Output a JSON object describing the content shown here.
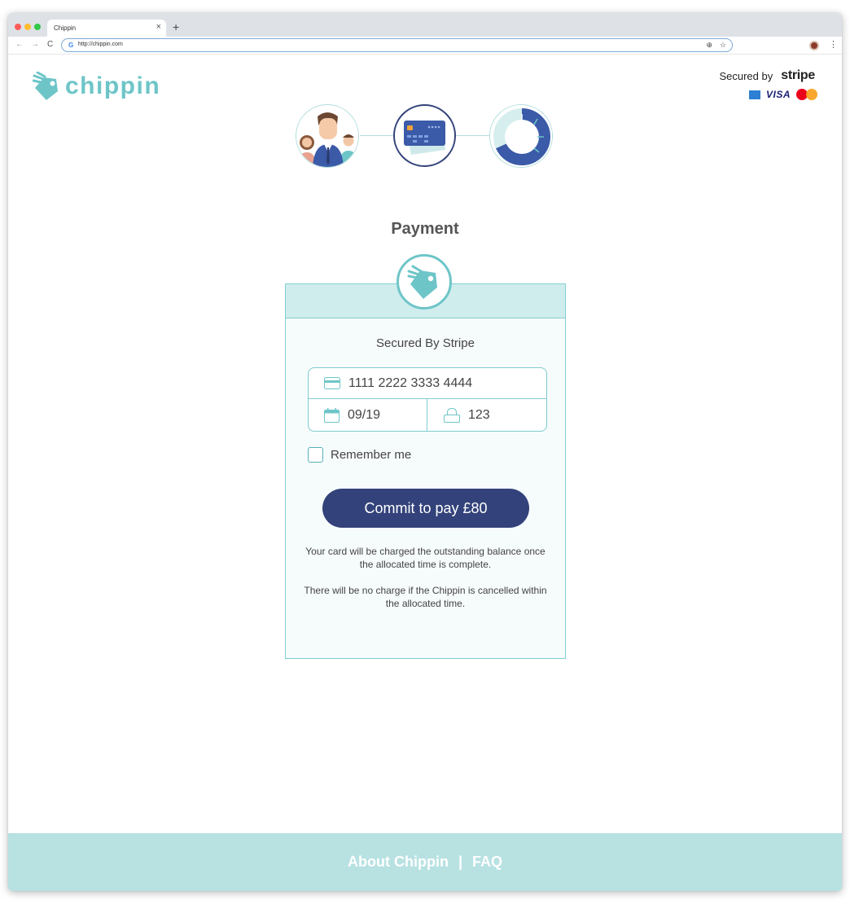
{
  "browser": {
    "tab_title": "Chippin",
    "tab_close": "×",
    "new_tab": "+",
    "url": "http://chippin.com",
    "back": "←",
    "forward": "→",
    "reload": "C",
    "menu": "⋮"
  },
  "header": {
    "logo_text": "chippin",
    "secured_by": "Secured by",
    "stripe_wordmark": "stripe",
    "card_brands": [
      "amex",
      "VISA",
      "mastercard"
    ]
  },
  "steps": [
    {
      "name": "group",
      "state": "done"
    },
    {
      "name": "payment",
      "state": "active"
    },
    {
      "name": "progress",
      "state": "upcoming"
    }
  ],
  "page": {
    "title": "Payment"
  },
  "panel": {
    "subtitle": "Secured By Stripe",
    "card_number": "1111 2222 3333 4444",
    "expiry": "09/19",
    "cvc": "123",
    "remember_label": "Remember me",
    "remember_checked": false,
    "pay_button": "Commit to pay £80",
    "note_1": "Your card will be charged the outstanding balance once the allocated time is complete.",
    "note_2": "There will be no charge if the Chippin is cancelled within the allocated time."
  },
  "footer": {
    "about": "About Chippin",
    "separator": "|",
    "faq": "FAQ"
  },
  "colors": {
    "brand_teal": "#6ec5c8",
    "navy": "#33427a",
    "footer_bg": "#b8e1e2",
    "panel_head": "#d0eded"
  }
}
